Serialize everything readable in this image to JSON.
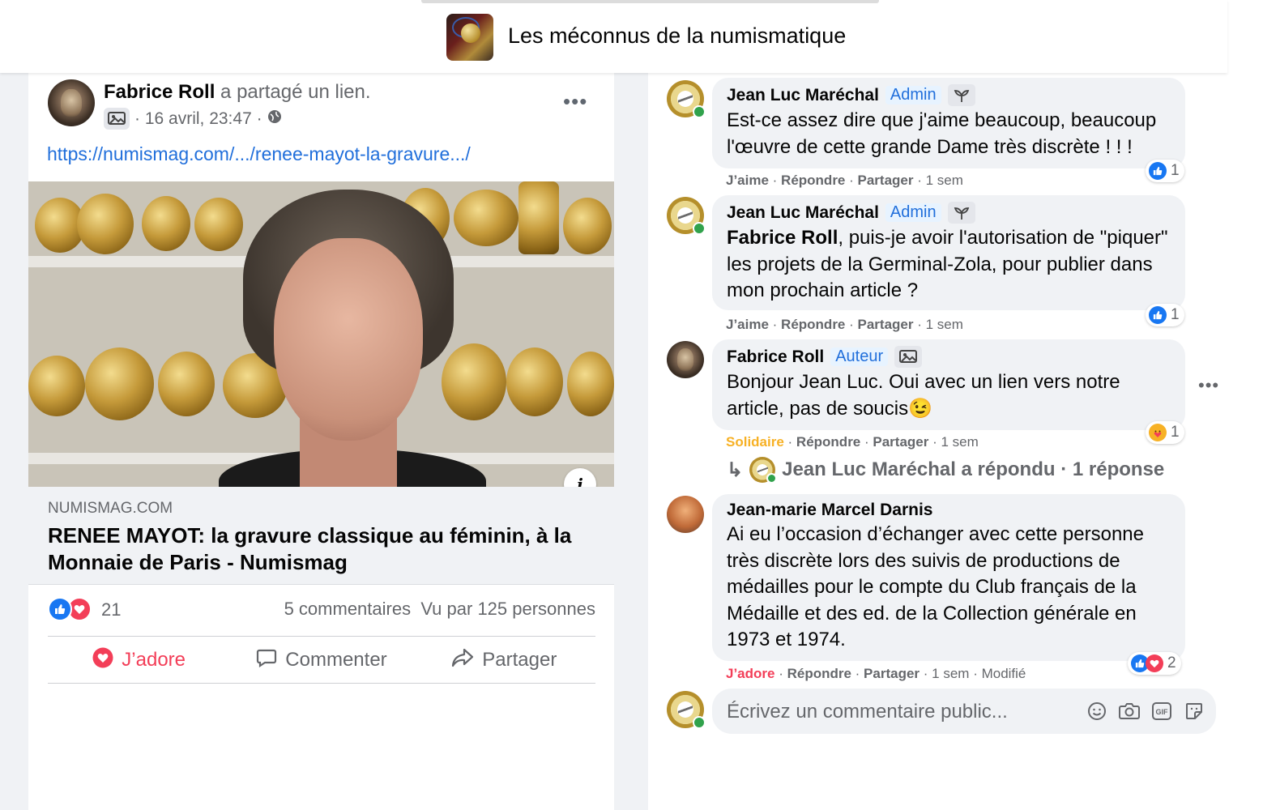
{
  "header": {
    "group_name": "Les méconnus de la numismatique"
  },
  "post": {
    "author": "Fabrice Roll",
    "action": "a partagé un lien.",
    "timestamp": "· 16 avril, 23:47 ·",
    "more": "•••",
    "url": "https://numismag.com/.../renee-mayot-la-gravure.../",
    "preview": {
      "domain": "NUMISMAG.COM",
      "title": "RENEE MAYOT: la gravure classique au féminin, à la Monnaie de Paris - Numismag",
      "info_icon": "i"
    },
    "reactions": {
      "count": "21",
      "comments": "5 commentaires",
      "views": "Vu par 125 personnes"
    },
    "actions": {
      "react": "J’adore",
      "comment": "Commenter",
      "share": "Partager"
    }
  },
  "comments": [
    {
      "author": "Jean Luc Maréchal",
      "role": "Admin",
      "text": "Est-ce assez dire que j'aime beaucoup, beaucoup l'œuvre de cette grande Dame très discrète ! ! !",
      "meta": {
        "react": "J’aime",
        "reply": "Répondre",
        "share": "Partager",
        "time": "· 1 sem"
      },
      "reaction_count": "1"
    },
    {
      "author": "Jean Luc Maréchal",
      "role": "Admin",
      "mention": "Fabrice Roll",
      "text": ", puis-je avoir l'autorisation de \"piquer\" les projets de la Germinal-Zola, pour publier dans mon prochain article ?",
      "meta": {
        "react": "J’aime",
        "reply": "Répondre",
        "share": "Partager",
        "time": "· 1 sem"
      },
      "reaction_count": "1"
    },
    {
      "author": "Fabrice Roll",
      "role": "Auteur",
      "text": "Bonjour Jean Luc. Oui avec un lien vers notre article, pas de soucis",
      "emoji": "😉",
      "meta": {
        "react": "Solidaire",
        "reply": "Répondre",
        "share": "Partager",
        "time": "· 1 sem"
      },
      "reaction_count": "1",
      "more": "•••",
      "replies": {
        "arrow": "↳",
        "text": "Jean Luc Maréchal a répondu · 1 réponse"
      }
    },
    {
      "author": "Jean-marie Marcel Darnis",
      "text": "Ai eu l’occasion d’échanger avec cette personne très discrète lors des suivis de productions de médailles pour le compte du Club français de la Médaille et des ed. de la Collection générale en 1973 et 1974.",
      "meta": {
        "react": "J’adore",
        "reply": "Répondre",
        "share": "Partager",
        "time": "· 1 sem",
        "edited": "· Modifié"
      },
      "reaction_count": "2"
    }
  ],
  "composer": {
    "placeholder": "Écrivez un commentaire public...",
    "icons": [
      "smiley-icon",
      "camera-icon",
      "gif-icon",
      "sticker-icon"
    ]
  },
  "colors": {
    "accent": "#1877f2",
    "love": "#f33e58",
    "link": "#216fdb",
    "care": "#f7b125"
  }
}
